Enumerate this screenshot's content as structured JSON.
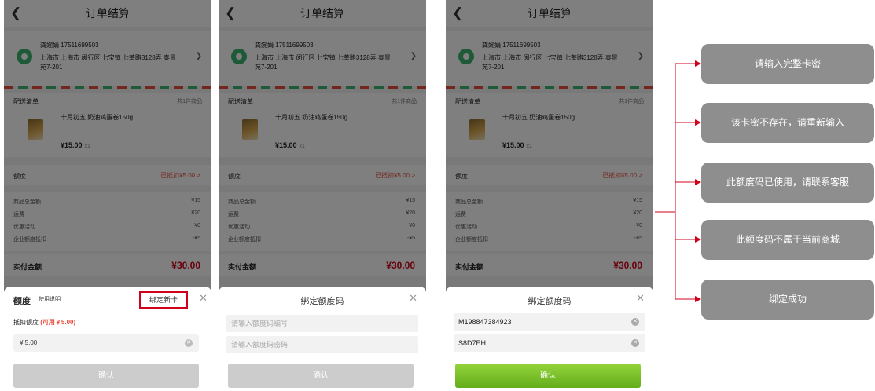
{
  "colors": {
    "accent_red": "#d0021b",
    "confirm_green": "#7bc12b",
    "bubble_gray": "#8e8e8e",
    "location_green": "#3cb371"
  },
  "order": {
    "nav_title": "订单结算",
    "back_icon": "chevron-left-icon",
    "address_name": "龚婉娟 17511699503",
    "address_line": "上海市 上海市 闵行区 七宝镇 七莘路3128弄 泰景苑7-201",
    "goods_title": "配送清单",
    "goods_count": "共1件商品",
    "goods_name": "十月初五 奶油鸡蛋卷150g",
    "goods_price": "¥15.00",
    "goods_qty": "x1",
    "quota_label": "额度",
    "quota_value": "已抵扣¥5.00 >",
    "costs": [
      {
        "label": "商品总金额",
        "value": "¥15"
      },
      {
        "label": "运费",
        "value": "¥20"
      },
      {
        "label": "优惠活动",
        "value": "¥0"
      },
      {
        "label": "企业额度抵扣",
        "value": "-¥5"
      }
    ],
    "total_label": "实付金额",
    "total_value": "¥30.00"
  },
  "panel1": {
    "title": "额度",
    "usage_link": "使用说明",
    "bind_new_label": "绑定新卡",
    "quota_text": "抵扣额度",
    "available": "(可用￥5.00)",
    "amount": "¥  5.00",
    "confirm_label": "确认"
  },
  "panel2": {
    "title": "绑定额度码",
    "code_placeholder": "请输入额度码编号",
    "password_placeholder": "请输入额度码密码",
    "confirm_label": "确认"
  },
  "panel3": {
    "title": "绑定额度码",
    "code_value": "M198847384923",
    "password_value": "S8D7EH",
    "confirm_label": "确认"
  },
  "messages": [
    "请输入完整卡密",
    "该卡密不存在，请重新输入",
    "此额度码已使用，请联系客服",
    "此额度码不属于当前商城",
    "绑定成功"
  ]
}
